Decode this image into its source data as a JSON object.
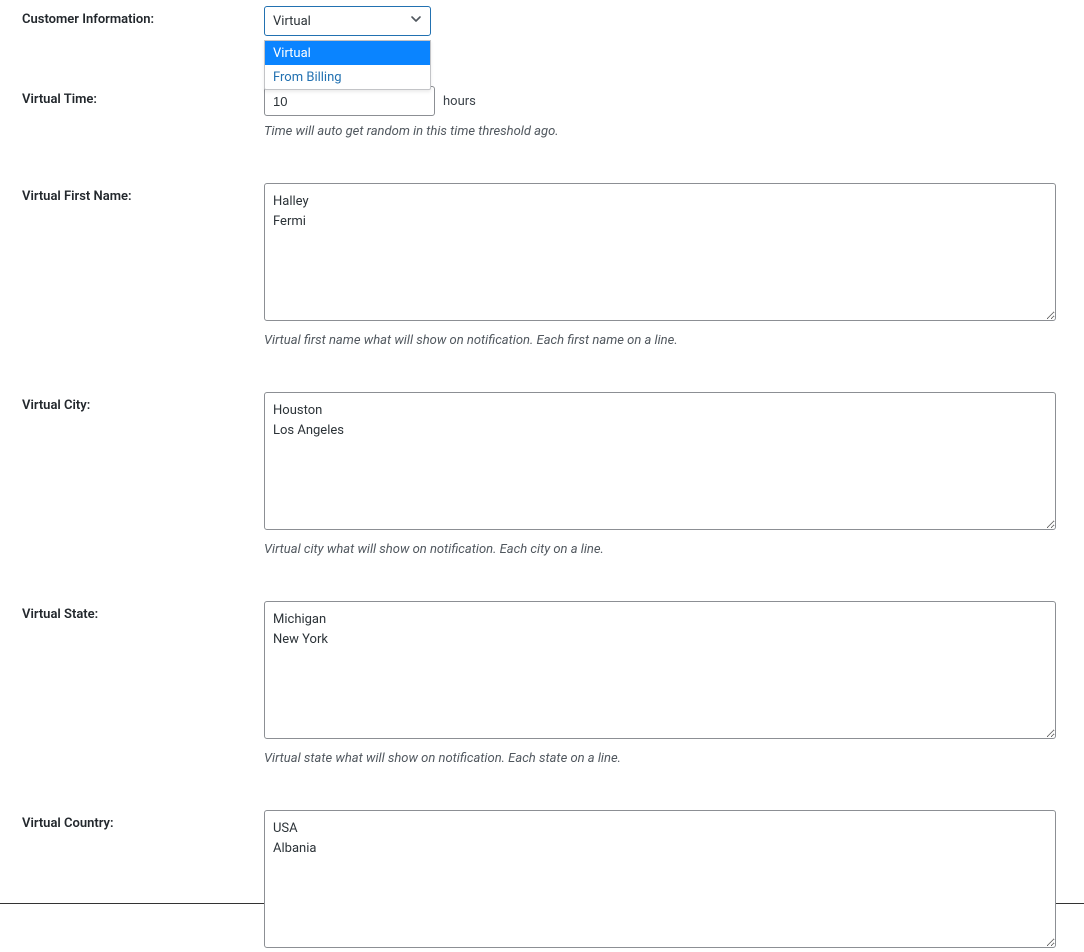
{
  "customerInfo": {
    "label": "Customer Information:",
    "selected": "Virtual",
    "options": [
      "Virtual",
      "From Billing"
    ]
  },
  "virtualTime": {
    "label": "Virtual Time:",
    "value": "10",
    "unit": "hours",
    "help": "Time will auto get random in this time threshold ago."
  },
  "virtualFirstName": {
    "label": "Virtual First Name:",
    "value": "Halley\nFermi",
    "help": "Virtual first name what will show on notification. Each first name on a line."
  },
  "virtualCity": {
    "label": "Virtual City:",
    "value": "Houston\nLos Angeles",
    "help": "Virtual city what will show on notification. Each city on a line."
  },
  "virtualState": {
    "label": "Virtual State:",
    "value": "Michigan\nNew York",
    "help": "Virtual state what will show on notification. Each state on a line."
  },
  "virtualCountry": {
    "label": "Virtual Country:",
    "value": "USA\nAlbania"
  }
}
